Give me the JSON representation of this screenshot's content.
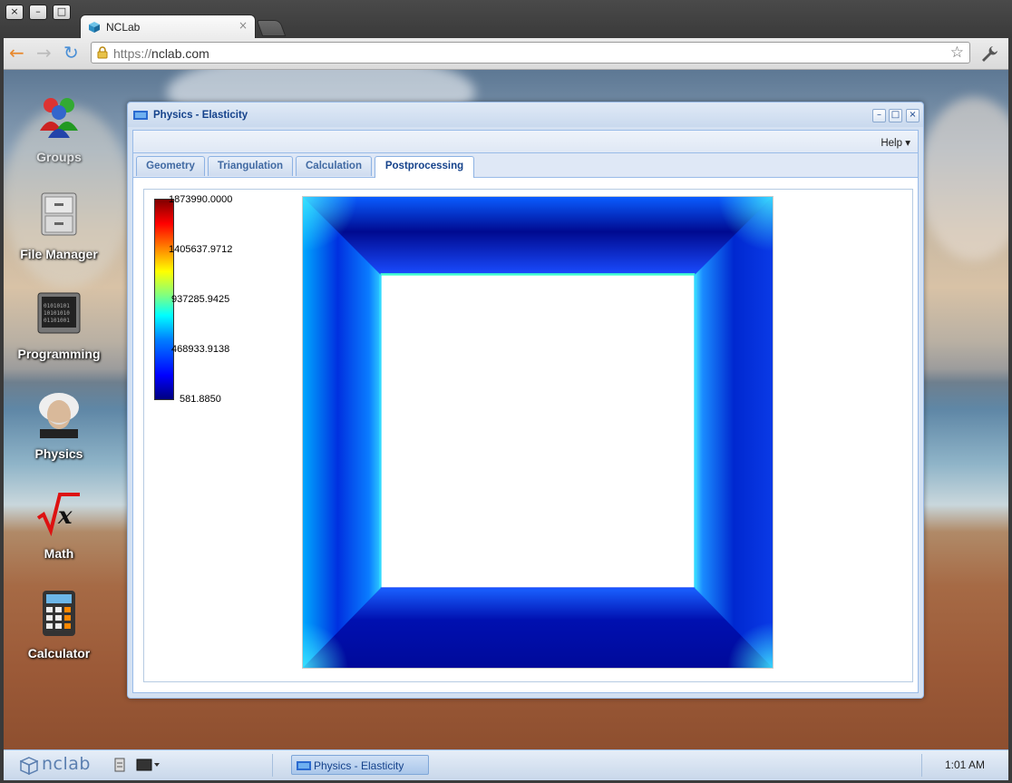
{
  "browser": {
    "tab_title": "NCLab",
    "tab_close": "×",
    "url_scheme": "https://",
    "url_host": "nclab.com",
    "window_buttons": [
      "×",
      "–",
      "□"
    ],
    "star": "☆"
  },
  "desktop": {
    "icons": [
      {
        "label": "Groups"
      },
      {
        "label": "File Manager"
      },
      {
        "label": "Programming"
      },
      {
        "label": "Physics"
      },
      {
        "label": "Math"
      },
      {
        "label": "Calculator"
      }
    ]
  },
  "app_window": {
    "title": "Physics - Elasticity",
    "help_menu": "Help",
    "tabs": [
      {
        "label": "Geometry"
      },
      {
        "label": "Triangulation"
      },
      {
        "label": "Calculation"
      },
      {
        "label": "Postprocessing"
      }
    ],
    "active_tab": "Postprocessing",
    "colorbar": {
      "labels": [
        "1873990.0000",
        "1405637.9712",
        "937285.9425",
        "468933.9138",
        "581.8850"
      ],
      "max": 1873990.0,
      "min": 581.885
    }
  },
  "taskbar": {
    "logo_text": "nclab",
    "task_label": "Physics - Elasticity",
    "clock": "1:01 AM"
  },
  "colors": {
    "window_title_text": "#15428b",
    "tab_text": "#416aa3",
    "window_border": "#99bbe8"
  }
}
